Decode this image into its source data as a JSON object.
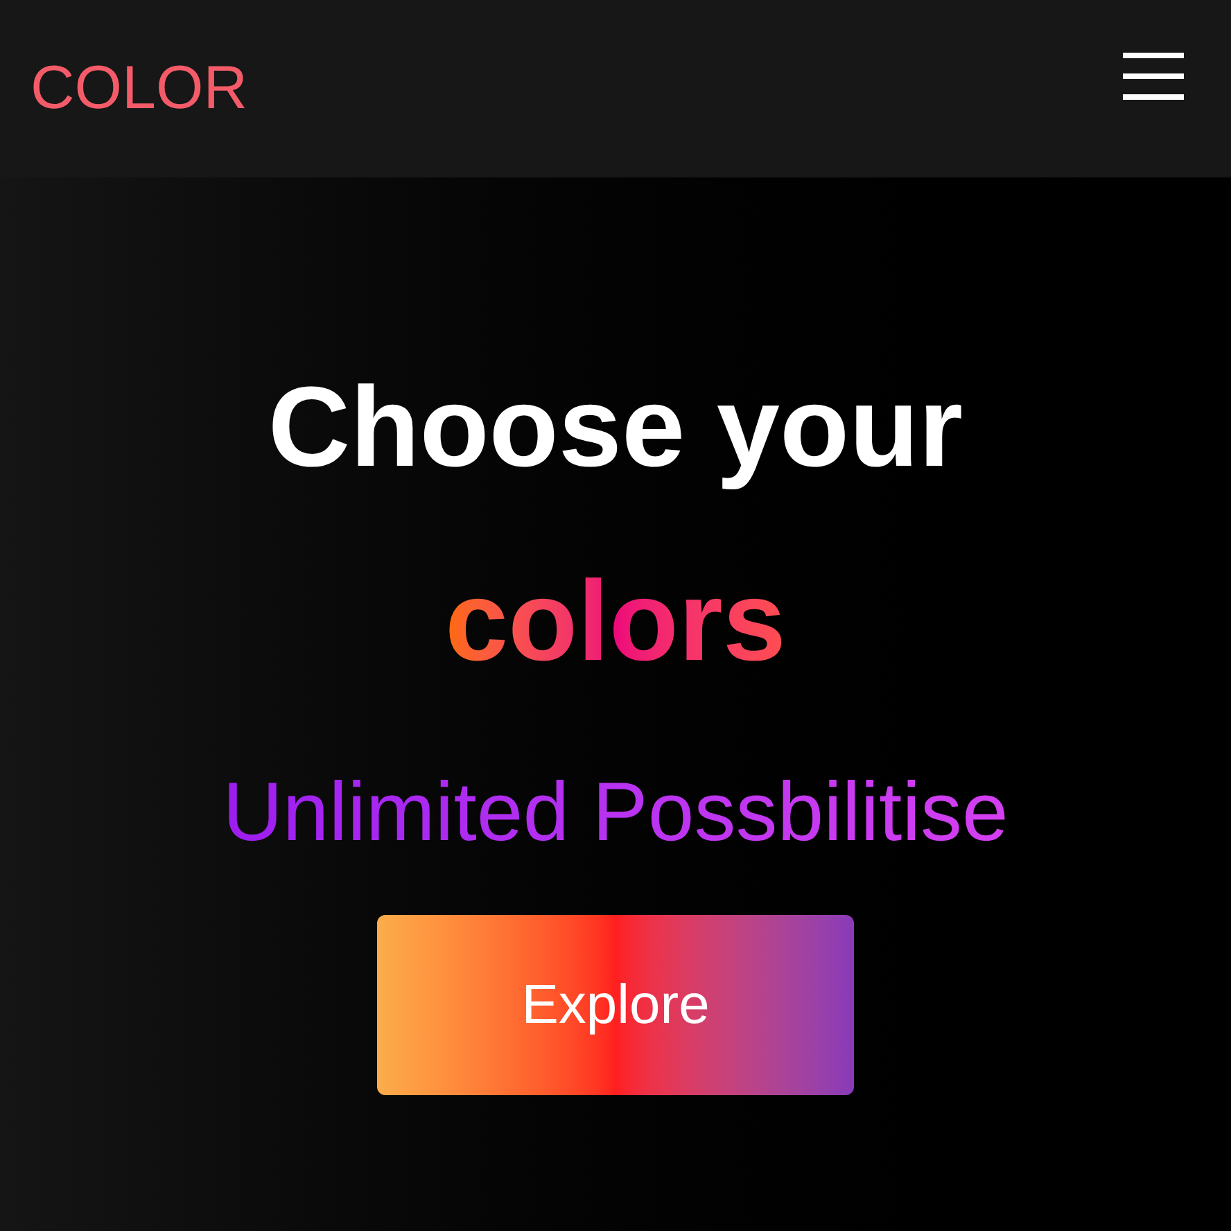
{
  "header": {
    "logo": "COLOR"
  },
  "hero": {
    "title": "Choose your",
    "highlight": "colors",
    "subtitle": "Unlimited Possbilitise",
    "button": "Explore"
  }
}
